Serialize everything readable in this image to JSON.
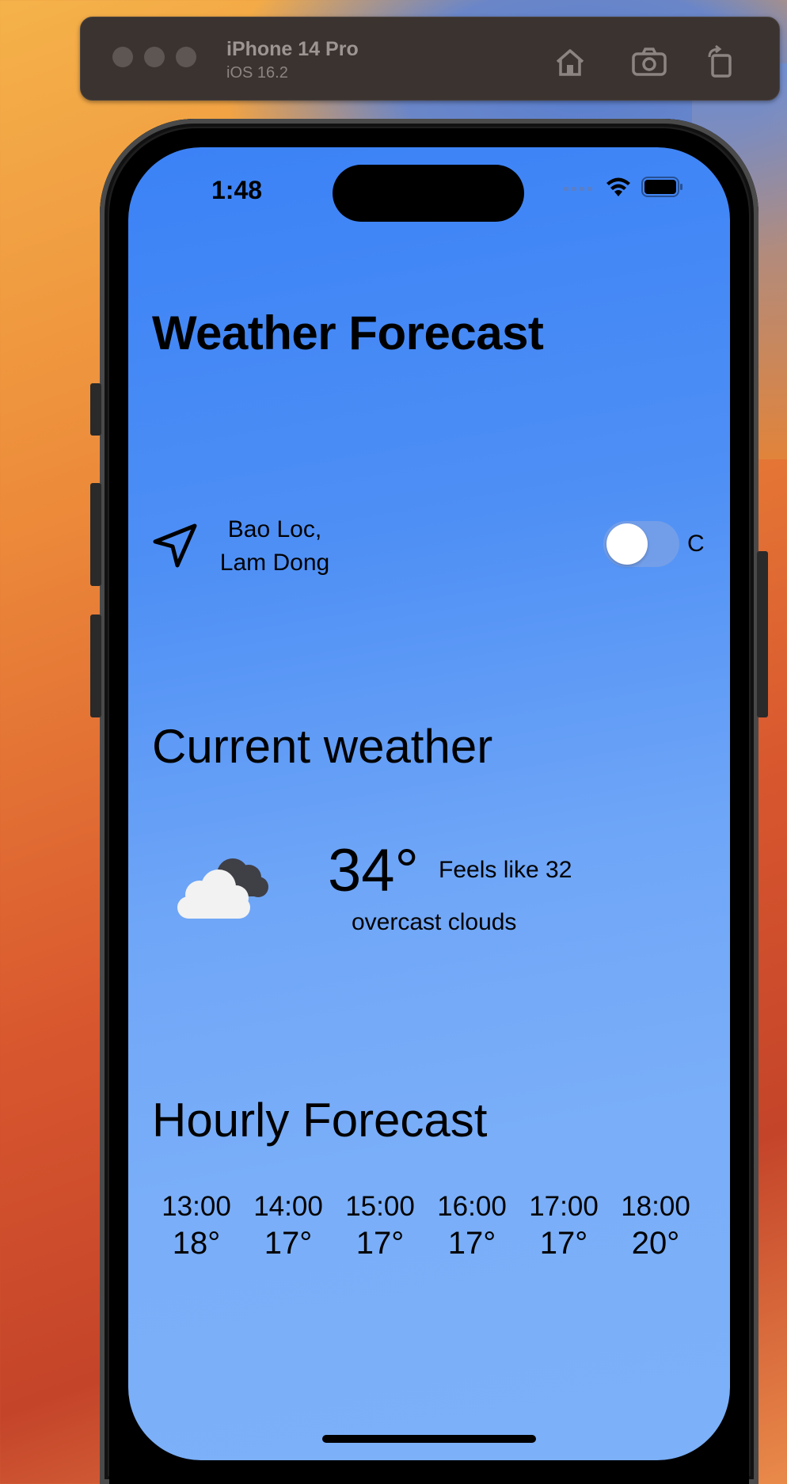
{
  "simulator": {
    "device_name": "iPhone 14 Pro",
    "os_version": "iOS 16.2",
    "buttons": [
      "home-icon",
      "screenshot-icon",
      "rotate-icon"
    ]
  },
  "status_bar": {
    "time": "1:48",
    "icons": [
      "cellular-icon",
      "wifi-icon",
      "battery-icon"
    ]
  },
  "app": {
    "title": "Weather Forecast",
    "location": {
      "city": "Bao Loc,",
      "region": "Lam Dong",
      "icon": "location-arrow-icon"
    },
    "unit_toggle": {
      "label": "C",
      "on": false
    },
    "current": {
      "heading": "Current weather",
      "icon": "cloud-icon",
      "temperature": "34°",
      "feels_like": "Feels like 32",
      "description": "overcast clouds"
    },
    "hourly": {
      "heading": "Hourly Forecast",
      "items": [
        {
          "time": "13:00",
          "temp": "18°"
        },
        {
          "time": "14:00",
          "temp": "17°"
        },
        {
          "time": "15:00",
          "temp": "17°"
        },
        {
          "time": "16:00",
          "temp": "17°"
        },
        {
          "time": "17:00",
          "temp": "17°"
        },
        {
          "time": "18:00",
          "temp": "20°"
        }
      ]
    }
  },
  "colors": {
    "screen_top": "#3b82f6",
    "screen_bottom": "#7cb0f8"
  }
}
